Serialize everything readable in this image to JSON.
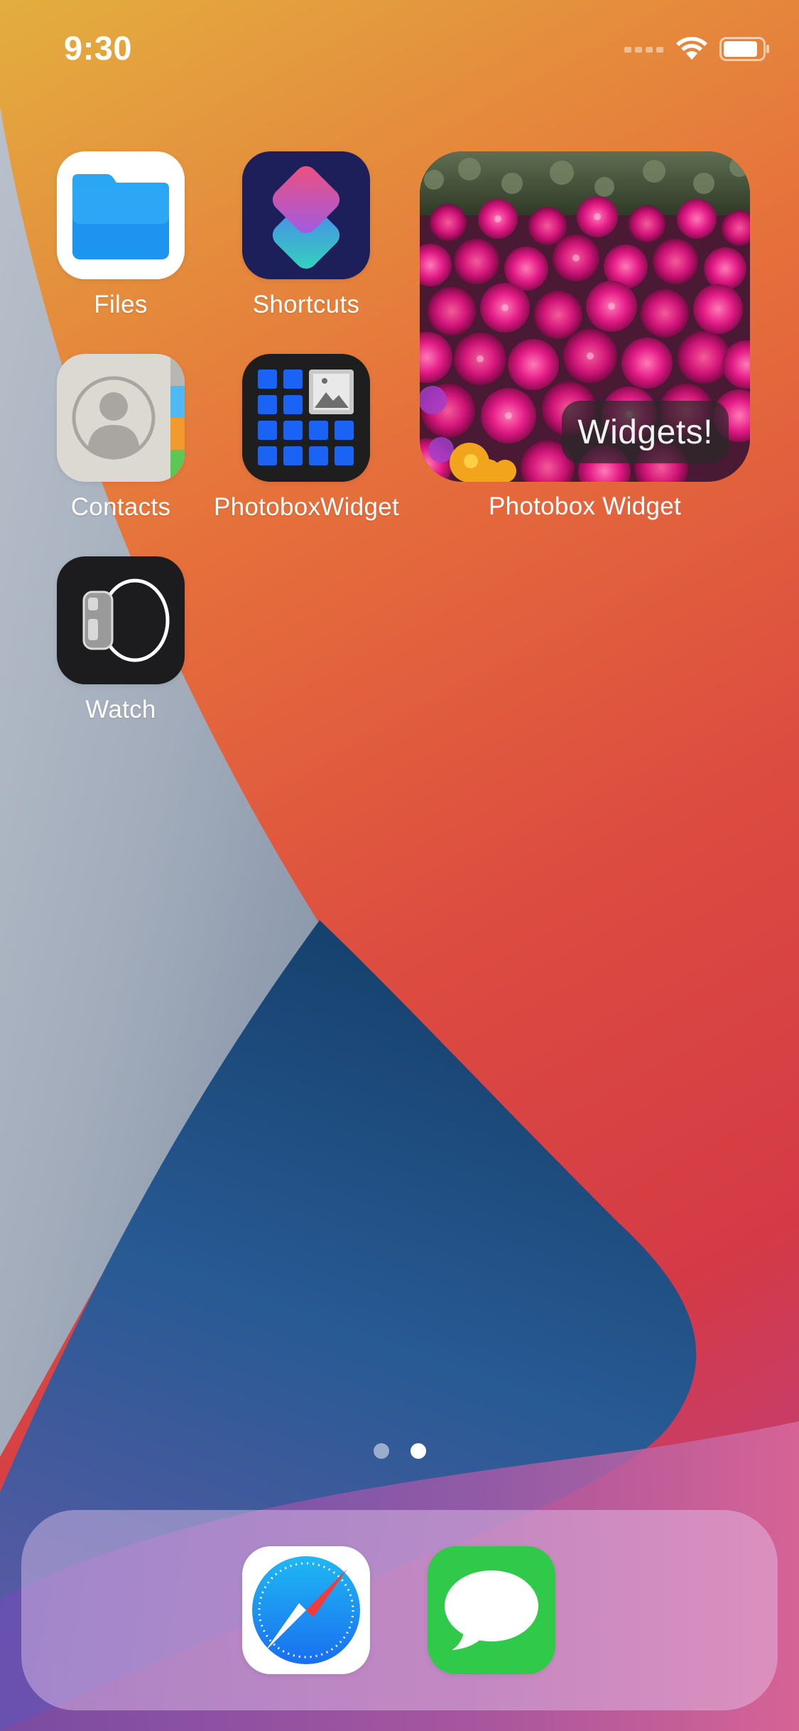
{
  "status_bar": {
    "time": "9:30",
    "signal_icon": "cellular-signal-icon",
    "wifi_icon": "wifi-icon",
    "battery_icon": "battery-icon"
  },
  "home_screen": {
    "apps": [
      {
        "label": "Files",
        "icon": "files-folder-icon"
      },
      {
        "label": "Shortcuts",
        "icon": "shortcuts-icon"
      },
      {
        "label": "Contacts",
        "icon": "contacts-icon"
      },
      {
        "label": "PhotoboxWidget",
        "icon": "photobox-widget-icon"
      },
      {
        "label": "Watch",
        "icon": "apple-watch-icon"
      }
    ],
    "widget": {
      "badge_text": "Widgets!",
      "label": "Photobox Widget",
      "image": "pink-flower-field-photo"
    }
  },
  "page_indicator": {
    "count": 2,
    "current": 2
  },
  "dock": {
    "apps": [
      {
        "label": "Safari",
        "icon": "safari-compass-icon"
      },
      {
        "label": "Messages",
        "icon": "messages-bubble-icon"
      }
    ]
  },
  "colors": {
    "wallpaper_orange": "#e5a33c",
    "wallpaper_red": "#d8443e",
    "wallpaper_blue": "#1f4f86",
    "wallpaper_grey": "#a9b3c2",
    "files_blue": "#1ea0f8",
    "messages_green": "#30c94a",
    "photobox_blue": "#1a63f5"
  }
}
